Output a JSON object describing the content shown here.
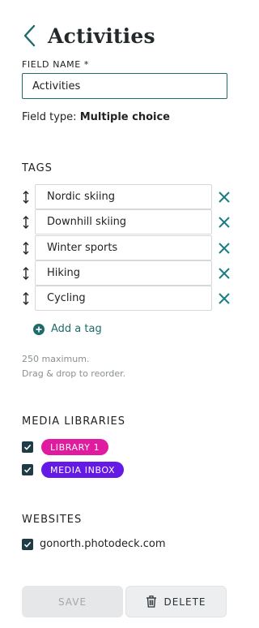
{
  "header": {
    "title": "Activities",
    "back_icon": "chevron-left-icon"
  },
  "field": {
    "label": "FIELD NAME *",
    "value": "Activities",
    "type_prefix": "Field type:",
    "type_value": "Multiple choice"
  },
  "tags": {
    "title": "TAGS",
    "items": [
      {
        "label": "Nordic skiing"
      },
      {
        "label": "Downhill skiing"
      },
      {
        "label": "Winter sports"
      },
      {
        "label": "Hiking"
      },
      {
        "label": "Cycling"
      }
    ],
    "add_label": "Add a tag",
    "hint_max": "250 maximum.",
    "hint_reorder": "Drag & drop to reorder."
  },
  "media_libraries": {
    "title": "MEDIA LIBRARIES",
    "items": [
      {
        "label": "LIBRARY 1",
        "color": "#e01ba0",
        "checked": true
      },
      {
        "label": "MEDIA INBOX",
        "color": "#6419e6",
        "checked": true
      }
    ]
  },
  "websites": {
    "title": "WEBSITES",
    "items": [
      {
        "label": "gonorth.photodeck.com",
        "checked": true
      }
    ]
  },
  "actions": {
    "save_label": "SAVE",
    "delete_label": "DELETE"
  },
  "colors": {
    "accent": "#1d6b6b",
    "checkbox": "#1f3b45"
  }
}
